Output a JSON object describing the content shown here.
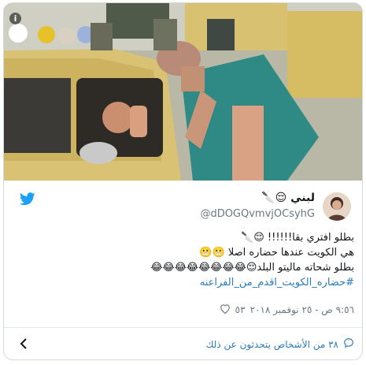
{
  "embed": {
    "media": {
      "alt": ""
    },
    "author": {
      "display_name": "لبني 😌🔪",
      "handle": "@dDOGQvmvjOCsyhG"
    },
    "tweet_lines": [
      "بطلو افتري بقا!!!!!! 😌🔪",
      "هي الكويت عندها حضاره اصلا 😬😬",
      "بطلو شحاته ماليتو البلد😌😂😂😂😂😂😂😂😂"
    ],
    "hashtag": "#حضاره_الكويت_اقدم_من_الفراعنه",
    "likes": "٥٣",
    "timestamp": "٩:٥٦ ص - ٢٥ نوفمبر ٢٠١٨",
    "people_talking": "٣٨ من الأشخاص يتحدثون عن ذلك"
  },
  "colors": {
    "link": "#2b7bb9",
    "muted": "#697882",
    "twitter_blue": "#1da1f2"
  },
  "icons": [
    "info-icon",
    "twitter-bird-icon",
    "heart-icon",
    "chat-bubble-icon",
    "chevron-left-icon"
  ]
}
